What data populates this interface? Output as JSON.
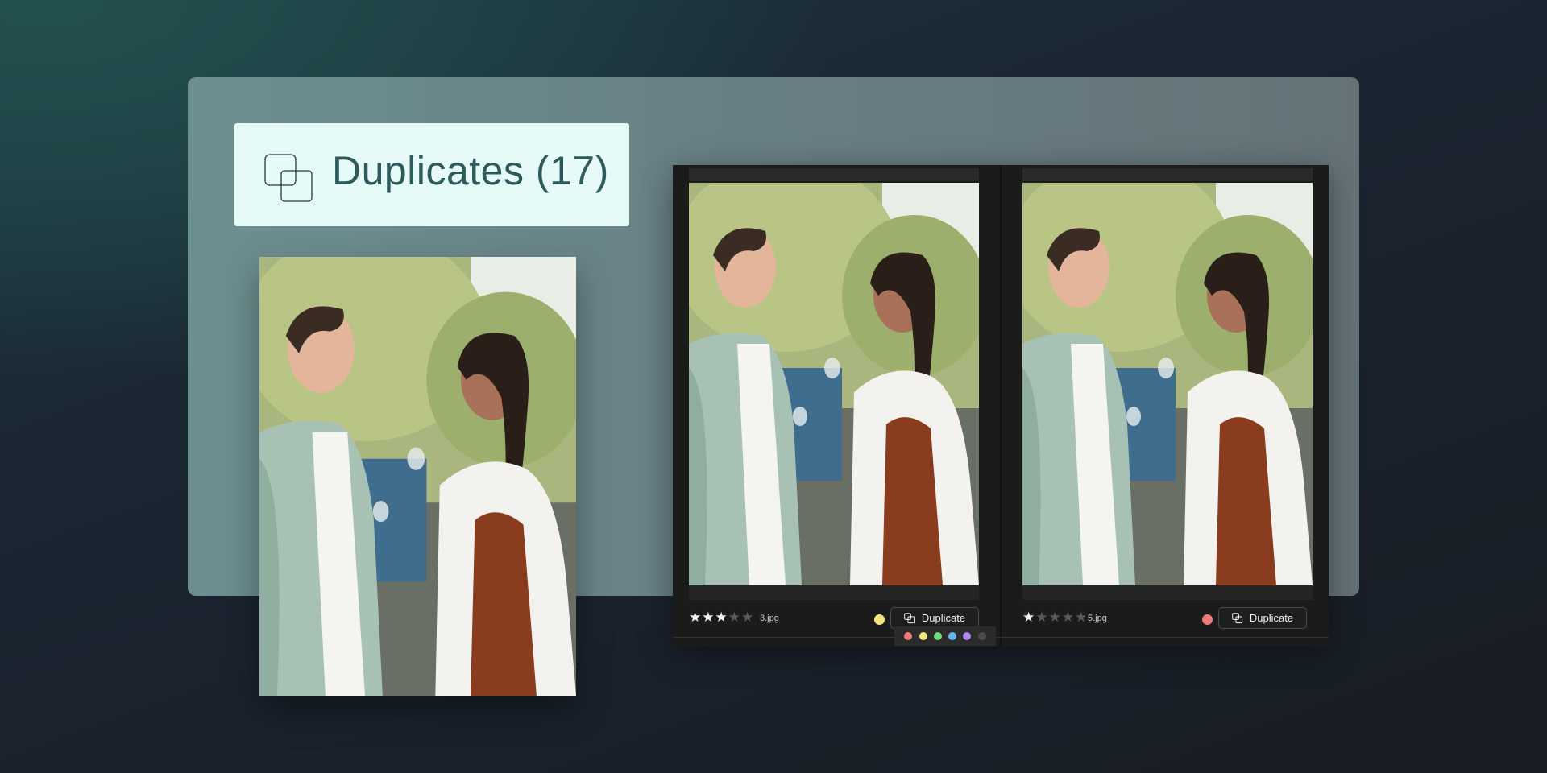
{
  "header": {
    "icon": "duplicates-icon",
    "title": "Duplicates (17)"
  },
  "compare": {
    "panes": [
      {
        "rating": 3,
        "max_rating": 5,
        "filename": "3.jpg",
        "color_label": "#f5e47a",
        "button_label": "Duplicate",
        "button_icon": "duplicate-icon"
      },
      {
        "rating": 1,
        "max_rating": 5,
        "filename": "5.jpg",
        "color_label": "#f07a7a",
        "button_label": "Duplicate",
        "button_icon": "duplicate-icon"
      }
    ],
    "color_options": [
      "#f07a7a",
      "#f5e47a",
      "#6fdc7f",
      "#62b8f2",
      "#b486ef",
      "#4a4a4a"
    ]
  },
  "colors": {
    "panel": "#6c8f8f",
    "header_card": "#e6fbf8",
    "header_text": "#2d5a5b",
    "window": "#1b1b1b"
  }
}
